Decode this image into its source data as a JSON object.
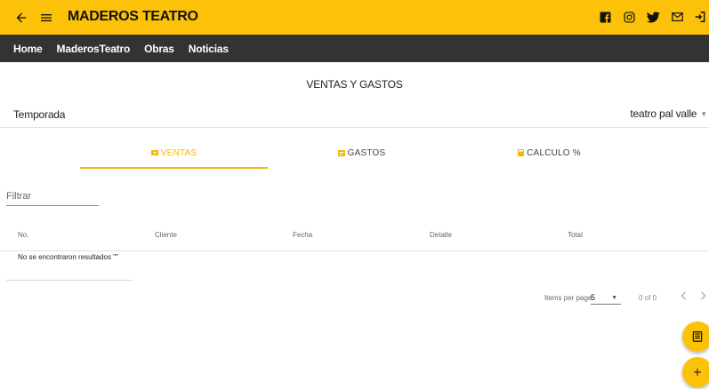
{
  "header": {
    "title": "MADEROS TEATRO",
    "back_icon": "arrow-left-icon",
    "menu_icon": "hamburger-menu-icon",
    "social_icons": [
      "facebook-icon",
      "instagram-icon",
      "twitter-icon",
      "email-icon",
      "logout-icon"
    ],
    "bg_color": "#fcc20a"
  },
  "nav": {
    "items": [
      "Home",
      "MaderosTeatro",
      "Obras",
      "Noticias"
    ],
    "bg_color": "#333333"
  },
  "page": {
    "title": "VENTAS Y GASTOS",
    "season_label": "Temporada",
    "season_value": "teatro pal valle"
  },
  "tabs": [
    {
      "label": "VENTAS",
      "icon": "money-icon",
      "active": true
    },
    {
      "label": "GASTOS",
      "icon": "receipt-icon",
      "active": false
    },
    {
      "label": "CALCULO %",
      "icon": "calculator-icon",
      "active": false
    }
  ],
  "filter": {
    "placeholder": "Filtrar",
    "value": ""
  },
  "table": {
    "columns": [
      "No.",
      "Cliente",
      "Fecha",
      "Detalle",
      "Total"
    ],
    "rows": [],
    "empty_message": "No se encontraron resultados \"\""
  },
  "paginator": {
    "items_per_page_label": "Items per page:",
    "page_size": "5",
    "range_label": "0 of 0"
  },
  "fabs": [
    {
      "icon": "report-icon"
    },
    {
      "icon": "plus-icon"
    }
  ],
  "accent_color": "#f5b800"
}
